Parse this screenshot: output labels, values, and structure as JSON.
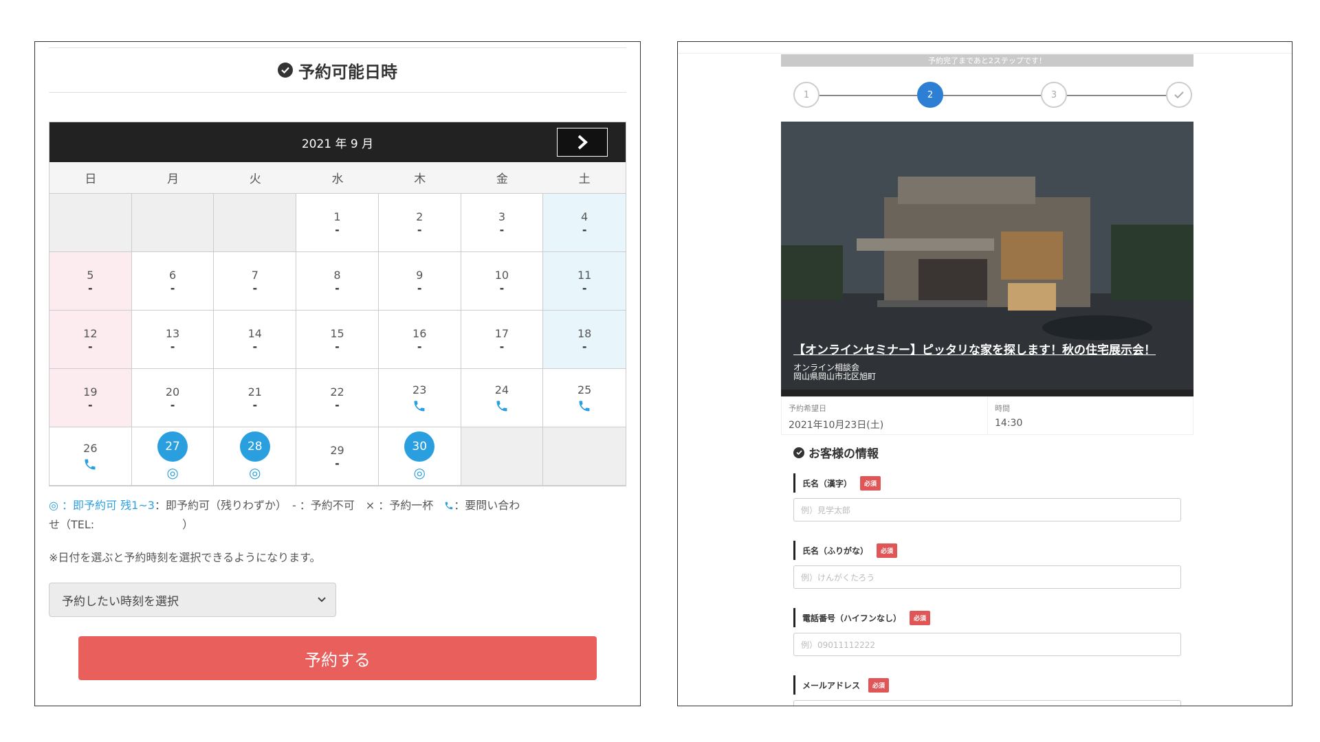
{
  "left": {
    "title": "予約可能日時",
    "month_label": "2021 年 9 月",
    "weekdays": [
      "日",
      "月",
      "火",
      "水",
      "木",
      "金",
      "土"
    ],
    "legend_line1_a": "◎ ：即予約可",
    "legend_line1_b": "残1~3",
    "legend_line1_c": "：即予約可（残りわずか）　- ：予約不可　× ：予約一杯　",
    "legend_line1_d": "：要問い合わ",
    "legend_line2": "せ（TEL:　　　　　　　　）",
    "note": "※日付を選ぶと予約時刻を選択できるようになります。",
    "time_select": "予約したい時刻を選択",
    "reserve_button": "予約する",
    "days": {
      "d1": "1",
      "d2": "2",
      "d3": "3",
      "d4": "4",
      "d5": "5",
      "d6": "6",
      "d7": "7",
      "d8": "8",
      "d9": "9",
      "d10": "10",
      "d11": "11",
      "d12": "12",
      "d13": "13",
      "d14": "14",
      "d15": "15",
      "d16": "16",
      "d17": "17",
      "d18": "18",
      "d19": "19",
      "d20": "20",
      "d21": "21",
      "d22": "22",
      "d23": "23",
      "d24": "24",
      "d25": "25",
      "d26": "26",
      "d27": "27",
      "d28": "28",
      "d29": "29",
      "d30": "30"
    },
    "dash": "-",
    "avail_mark": "◎",
    "colors": {
      "accent_blue": "#2a9fe0",
      "reserve_red": "#e85f5c",
      "sun_bg": "#fdecef",
      "sat_bg": "#e8f6fc"
    }
  },
  "right": {
    "banner": "予約完了まであと2ステップです！",
    "steps": [
      "1",
      "2",
      "3"
    ],
    "hero_title": "【オンラインセミナー】ピッタリな家を探します！秋の住宅展示会！",
    "hero_sub1": "オンライン相談会",
    "hero_sub2": "岡山県岡山市北区旭町",
    "date_label": "予約希望日",
    "date_value": "2021年10月23日(土)",
    "time_label": "時間",
    "time_value": "14:30",
    "customer_title": "お客様の情報",
    "required": "必須",
    "fields": [
      {
        "label": "氏名（漢字）",
        "placeholder": "例）見学太郎"
      },
      {
        "label": "氏名（ふりがな）",
        "placeholder": "例）けんがくたろう"
      },
      {
        "label": "電話番号（ハイフンなし）",
        "placeholder": "例）09011112222"
      },
      {
        "label": "メールアドレス",
        "placeholder": ""
      }
    ],
    "colors": {
      "step_active": "#2d7fd3",
      "required_red": "#e05555"
    }
  }
}
